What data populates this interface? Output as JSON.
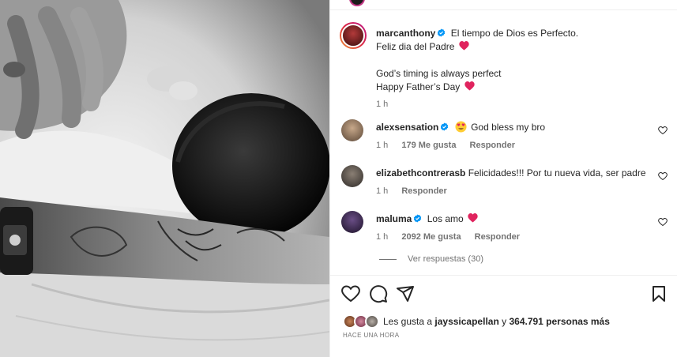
{
  "post": {
    "author": "marcanthony",
    "caption_line1": "El tiempo de Dios es Perfecto.",
    "caption_line2": "Feliz dia del Padre",
    "caption_line3": "God’s timing is always perfect",
    "caption_line4": "Happy Father’s Day",
    "time": "1 h"
  },
  "comments": [
    {
      "user": "alexsensation",
      "verified": true,
      "text": "God bless my bro",
      "time": "1 h",
      "likes": "179 Me gusta",
      "reply": "Responder"
    },
    {
      "user": "elizabethcontrerasb",
      "verified": false,
      "text": "Felicidades!!! Por tu nueva vida, ser padre",
      "time": "1 h",
      "reply": "Responder"
    },
    {
      "user": "maluma",
      "verified": true,
      "text": "Los amo",
      "time": "1 h",
      "likes": "2092 Me gusta",
      "reply": "Responder"
    }
  ],
  "view_replies": "Ver respuestas (30)",
  "likes_summary": {
    "prefix": "Les gusta a",
    "user": "jayssicapellan",
    "joiner": "y",
    "count": "364.791 personas más"
  },
  "timestamp": "HACE UNA HORA",
  "icons": {
    "verified": "verified-badge-icon",
    "like": "heart-outline-icon",
    "comment": "comment-icon",
    "share": "paper-plane-icon",
    "save": "bookmark-icon",
    "emoji_heart": "red-heart-emoji",
    "emoji_heart_eyes": "heart-eyes-emoji"
  },
  "colors": {
    "verified_blue": "#0095f6",
    "heart_red": "#ed4956",
    "muted": "#737373",
    "text": "#262626"
  }
}
